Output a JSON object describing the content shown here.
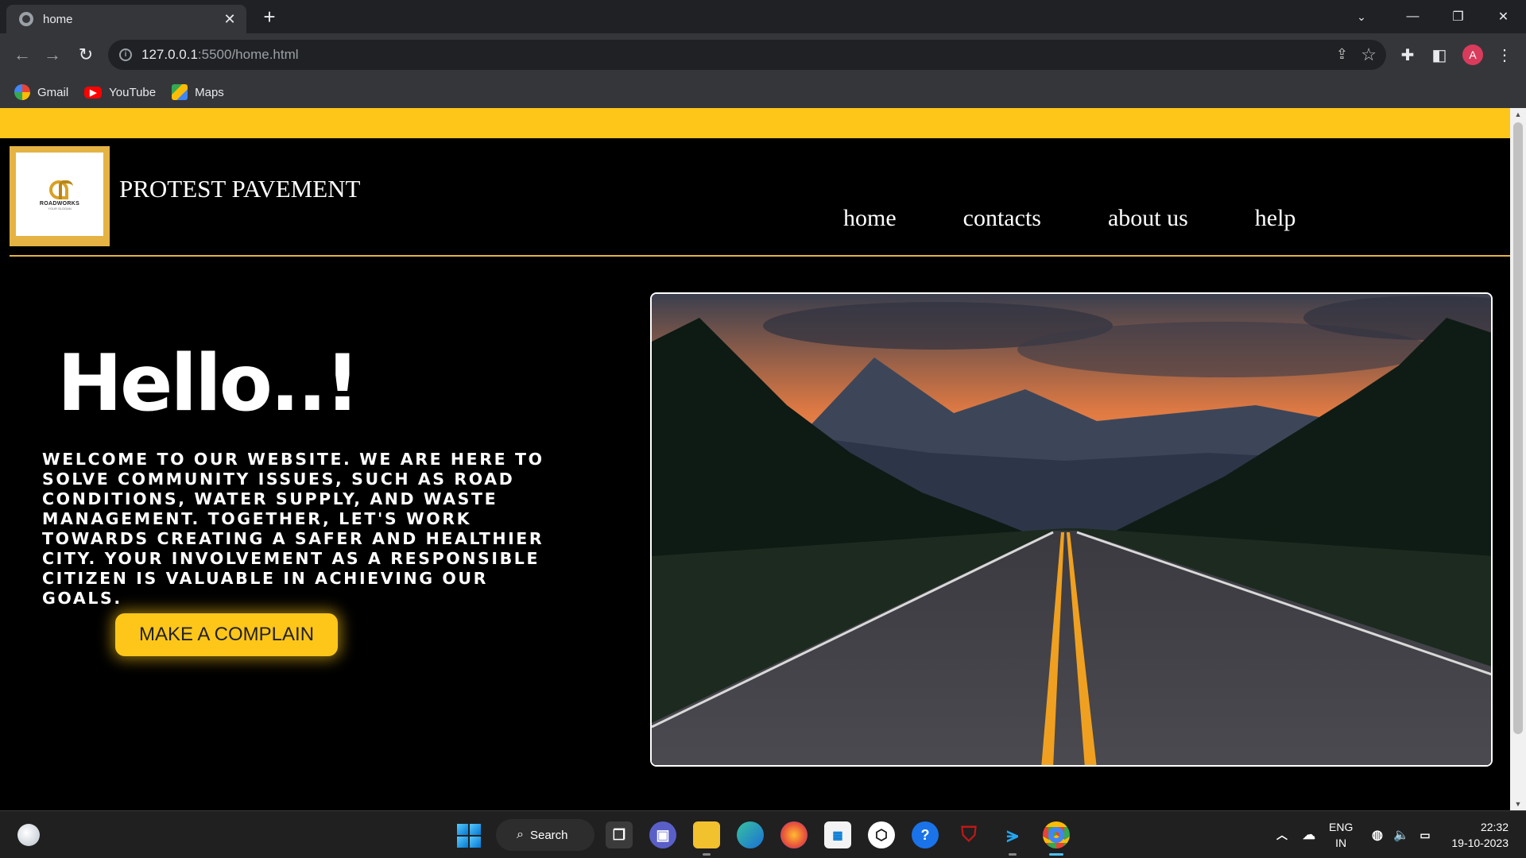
{
  "browser": {
    "tab_title": "home",
    "url_host": "127.0.0.1",
    "url_rest": ":5500/home.html",
    "profile_initial": "A",
    "bookmarks": [
      {
        "label": "Gmail",
        "icon": "gmail-icon"
      },
      {
        "label": "YouTube",
        "icon": "youtube-icon"
      },
      {
        "label": "Maps",
        "icon": "maps-icon"
      }
    ]
  },
  "site": {
    "logo_text": "ROADWORKS",
    "logo_sub": "YOUR SLOGAN",
    "title": "PROTEST PAVEMENT",
    "nav": [
      "home",
      "contacts",
      "about us",
      "help"
    ],
    "hero_heading": "Hello..!",
    "hero_text": "WELCOME TO OUR WEBSITE. WE ARE HERE TO SOLVE COMMUNITY ISSUES, SUCH AS ROAD CONDITIONS, WATER SUPPLY, AND WASTE MANAGEMENT. TOGETHER, LET'S WORK TOWARDS CREATING A SAFER AND HEALTHIER CITY. YOUR INVOLVEMENT AS A RESPONSIBLE CITIZEN IS VALUABLE IN ACHIEVING OUR GOALS.",
    "cta_label": "MAKE A COMPLAIN",
    "accent_color": "#ffc61a",
    "hero_image": "mountain-road-sunset-photo"
  },
  "taskbar": {
    "search_label": "Search",
    "lang_top": "ENG",
    "lang_bottom": "IN",
    "time": "22:32",
    "date": "19-10-2023"
  }
}
